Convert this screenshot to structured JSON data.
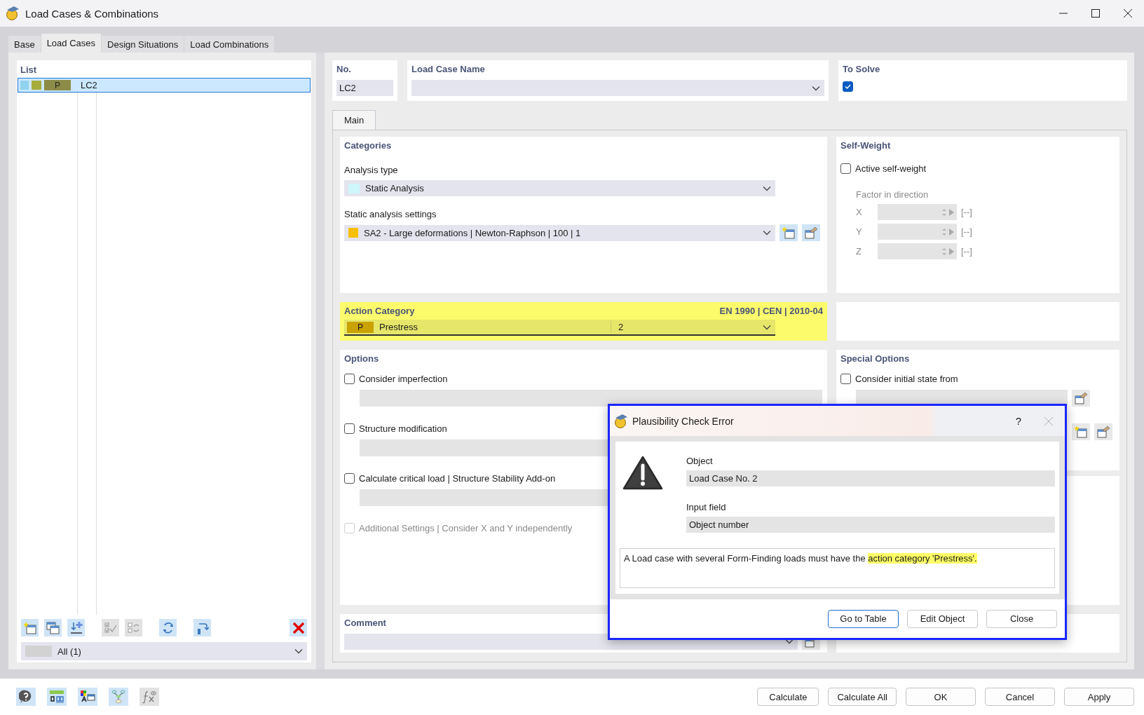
{
  "window": {
    "title": "Load Cases & Combinations"
  },
  "tabs": [
    {
      "label": "Base",
      "selected": false
    },
    {
      "label": "Load Cases",
      "selected": true
    },
    {
      "label": "Design Situations",
      "selected": false
    },
    {
      "label": "Load Combinations",
      "selected": false
    }
  ],
  "list": {
    "title": "List",
    "items": [
      {
        "swatches": [
          {
            "color": "#8fd3ef"
          },
          {
            "color": "#a8ac3c"
          }
        ],
        "tag": {
          "label": "P",
          "color": "#8c8c48"
        },
        "name": "LC2",
        "selected": true
      }
    ],
    "toolbar": [
      {
        "kind": "new",
        "disabled": false
      },
      {
        "kind": "copy",
        "disabled": false
      },
      {
        "kind": "import",
        "disabled": false
      },
      {
        "kind": "check-all",
        "disabled": true
      },
      {
        "kind": "check-toggle",
        "disabled": true
      },
      {
        "kind": "renumber",
        "disabled": false
      },
      {
        "kind": "reorder",
        "disabled": false
      },
      {
        "kind": "delete",
        "disabled": false
      }
    ],
    "filter": {
      "value": "All (1)"
    }
  },
  "header": {
    "no_label": "No.",
    "no_value": "LC2",
    "name_label": "Load Case Name",
    "solve_label": "To Solve",
    "to_solve": true
  },
  "subtabs": [
    {
      "label": "Main",
      "selected": true
    }
  ],
  "categories": {
    "title": "Categories",
    "analysis_label": "Analysis type",
    "analysis_value": "Static Analysis",
    "settings_label": "Static analysis settings",
    "settings_value": "SA2 - Large deformations | Newton-Raphson | 100 | 1"
  },
  "action_category": {
    "title": "Action Category",
    "standard": "EN 1990 | CEN | 2010-04",
    "code": "P",
    "value": "Prestress",
    "number": "2"
  },
  "self_weight": {
    "title": "Self-Weight",
    "active_label": "Active self-weight",
    "active": false,
    "factor_label": "Factor in direction",
    "axes": [
      {
        "axis": "X",
        "unit": "[--]"
      },
      {
        "axis": "Y",
        "unit": "[--]"
      },
      {
        "axis": "Z",
        "unit": "[--]"
      }
    ]
  },
  "options": {
    "title": "Options",
    "items": [
      {
        "label": "Consider imperfection",
        "checked": false,
        "disabled": false,
        "kind": "field"
      },
      {
        "label": "Structure modification",
        "checked": false,
        "disabled": false,
        "kind": "field"
      },
      {
        "label": "Calculate critical load | Structure Stability Add-on",
        "checked": false,
        "disabled": false,
        "kind": "field"
      },
      {
        "label": "Additional Settings | Consider X and Y independently",
        "checked": false,
        "disabled": true,
        "kind": "plain"
      }
    ]
  },
  "special_options": {
    "title": "Special Options",
    "items": [
      {
        "label": "Consider initial state from",
        "checked": false
      }
    ]
  },
  "comment": {
    "title": "Comment"
  },
  "dialog": {
    "title": "Plausibility Check Error",
    "help": "?",
    "object_label": "Object",
    "object_value": "Load Case No. 2",
    "input_label": "Input field",
    "input_value": "Object number",
    "message": [
      {
        "text": "A Load case with several Form-Finding loads must have the ",
        "highlight": false
      },
      {
        "text": "action category 'Prestress'.",
        "highlight": true
      }
    ],
    "buttons": [
      {
        "label": "Go to Table",
        "focused": true
      },
      {
        "label": "Edit Object",
        "focused": false
      },
      {
        "label": "Close",
        "focused": false
      }
    ]
  },
  "footer": {
    "tools": [
      {
        "kind": "help",
        "disabled": false
      },
      {
        "kind": "units",
        "disabled": false
      },
      {
        "kind": "colors",
        "disabled": false
      },
      {
        "kind": "tree",
        "disabled": false
      },
      {
        "kind": "formula",
        "disabled": true
      }
    ],
    "buttons": [
      "Calculate",
      "Calculate All",
      "OK",
      "Cancel",
      "Apply"
    ]
  }
}
